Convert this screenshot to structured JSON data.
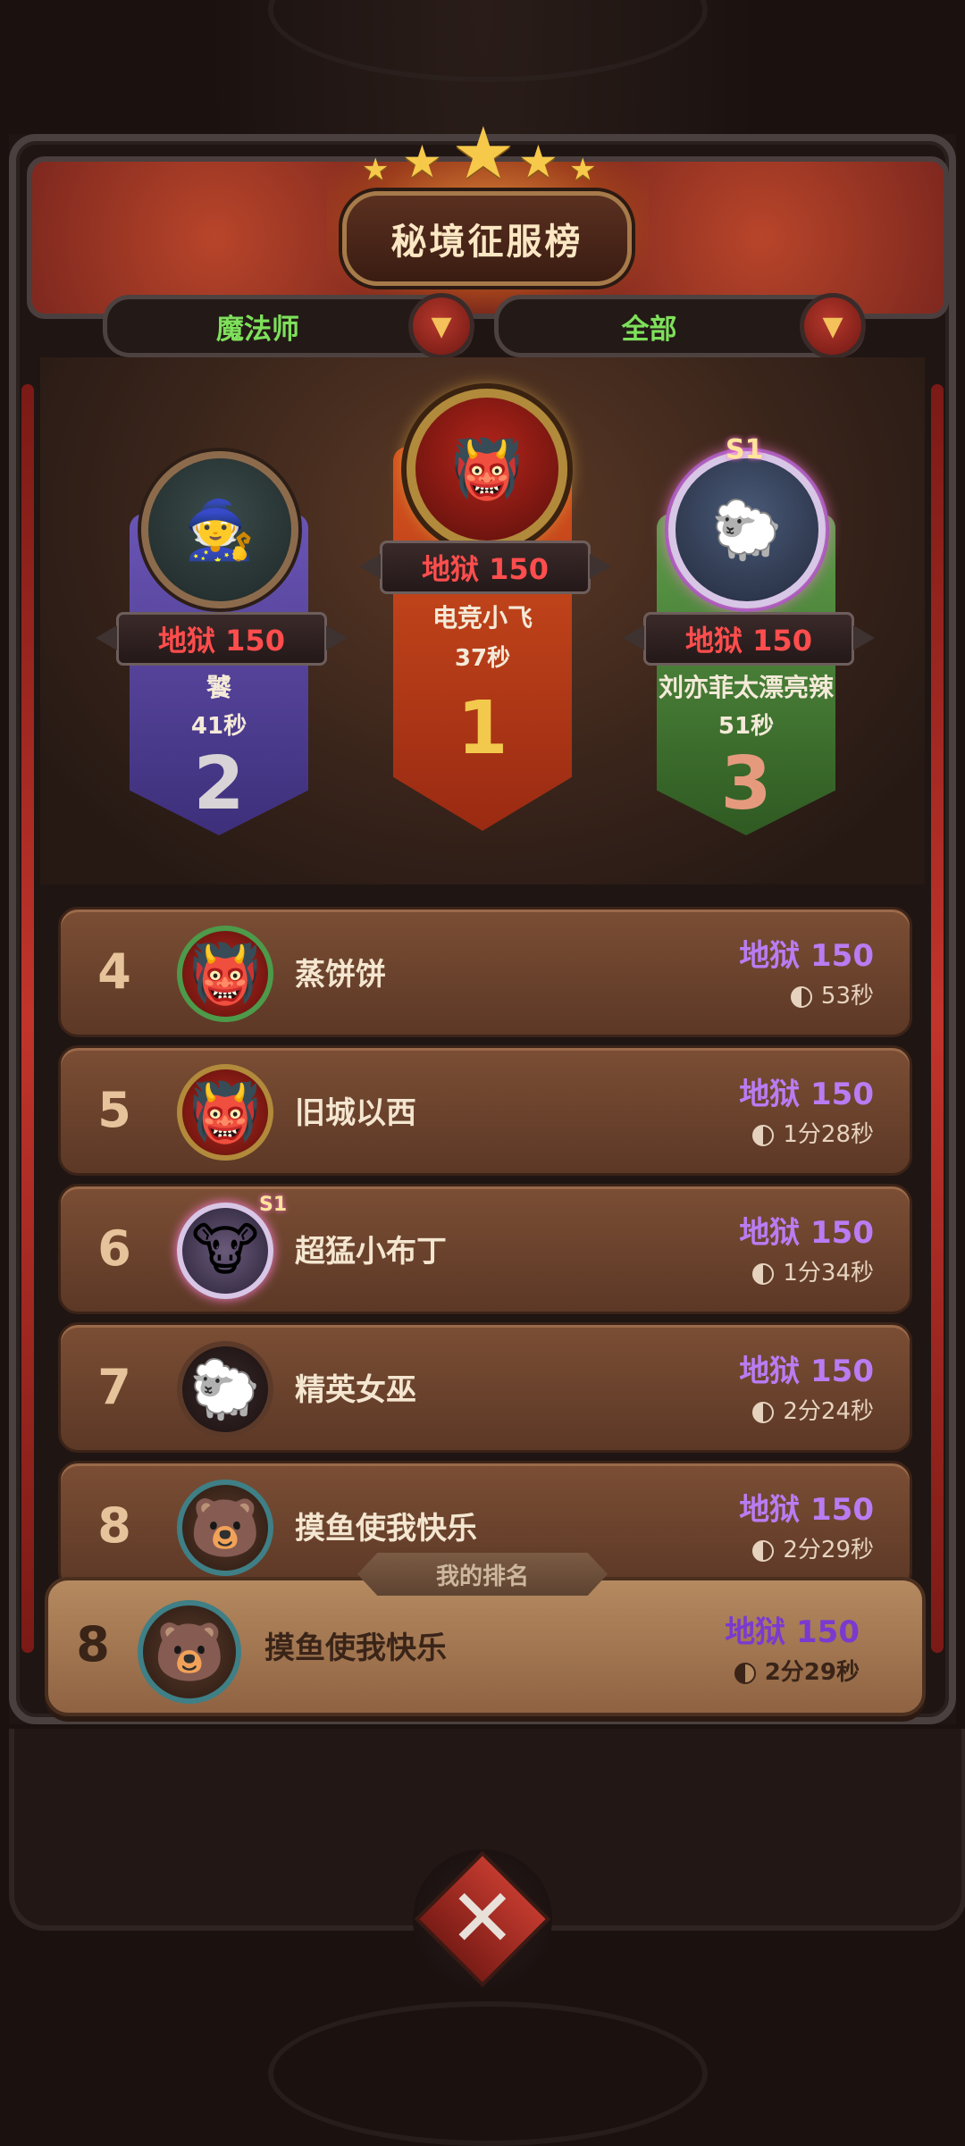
{
  "header": {
    "title": "秘境征服榜"
  },
  "filters": [
    {
      "label": "魔法师"
    },
    {
      "label": "全部"
    }
  ],
  "podium": {
    "first": {
      "difficulty": "地狱 150",
      "name": "电竞小飞",
      "time": "37秒",
      "rank": "1"
    },
    "second": {
      "difficulty": "地狱 150",
      "name": "饕",
      "time": "41秒",
      "rank": "2"
    },
    "third": {
      "difficulty": "地狱 150",
      "name": "刘亦菲太漂亮辣",
      "time": "51秒",
      "rank": "3",
      "badge": "S1"
    }
  },
  "rows": [
    {
      "rank": "4",
      "name": "蒸饼饼",
      "difficulty": "地狱 150",
      "time": "53秒"
    },
    {
      "rank": "5",
      "name": "旧城以西",
      "difficulty": "地狱 150",
      "time": "1分28秒"
    },
    {
      "rank": "6",
      "name": "超猛小布丁",
      "difficulty": "地狱 150",
      "time": "1分34秒",
      "badge": "S1"
    },
    {
      "rank": "7",
      "name": "精英女巫",
      "difficulty": "地狱 150",
      "time": "2分24秒"
    },
    {
      "rank": "8",
      "name": "摸鱼使我快乐",
      "difficulty": "地狱 150",
      "time": "2分29秒"
    }
  ],
  "my_rank": {
    "tag": "我的排名",
    "rank": "8",
    "name": "摸鱼使我快乐",
    "difficulty": "地狱 150",
    "time": "2分29秒"
  },
  "colors": {
    "difficulty_red": "#ff4d4d",
    "difficulty_purple": "#b97cf2",
    "filter_green": "#7ee05b"
  },
  "icons": {
    "filter_dropdown": "chevron-down-icon",
    "time": "clock-icon",
    "close": "close-icon"
  }
}
